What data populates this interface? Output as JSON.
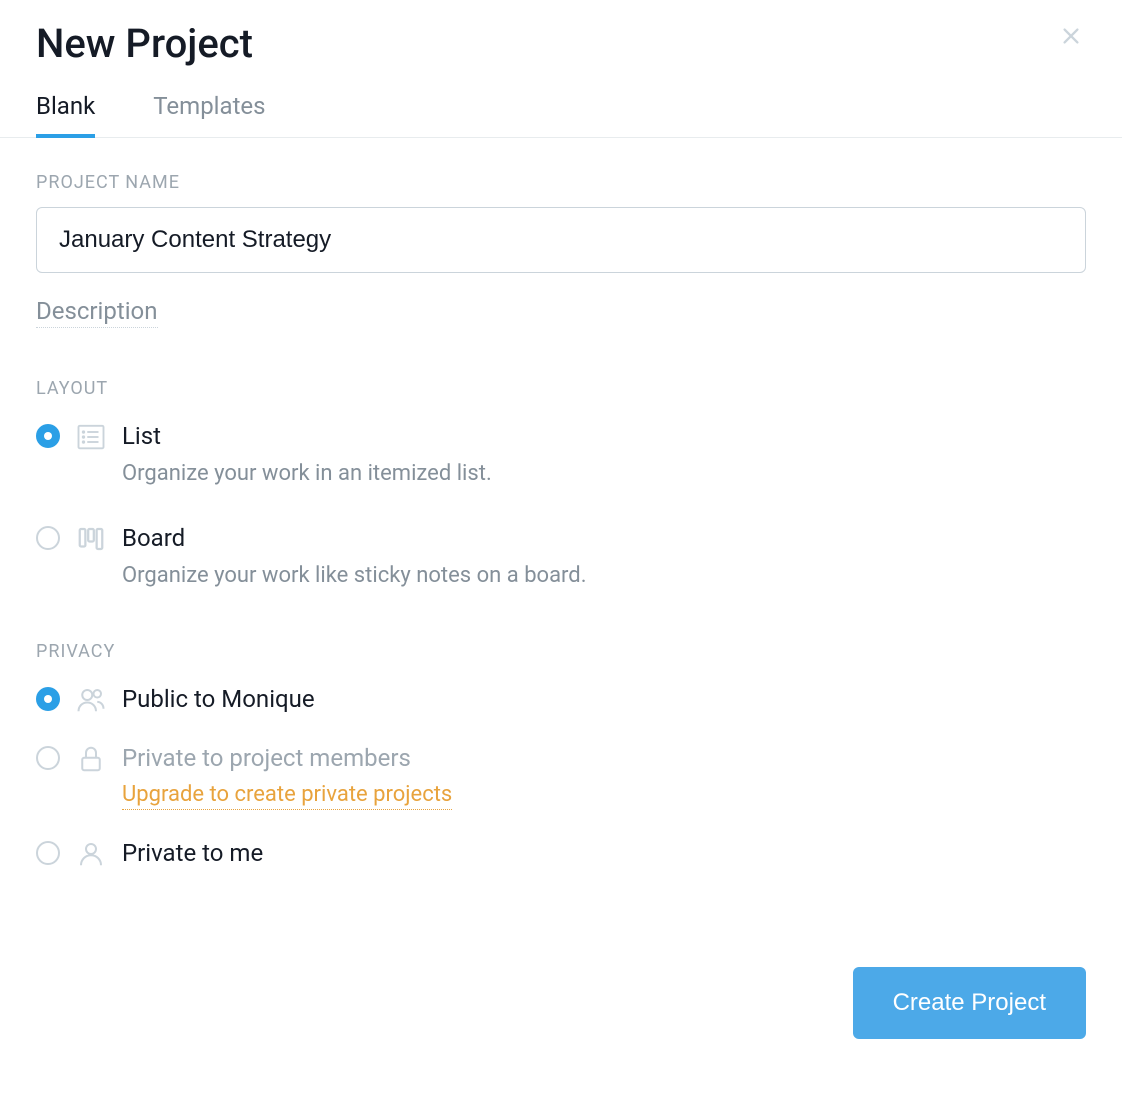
{
  "modal": {
    "title": "New Project",
    "tabs": [
      {
        "label": "Blank",
        "active": true
      },
      {
        "label": "Templates",
        "active": false
      }
    ],
    "project_name_label": "PROJECT NAME",
    "project_name_value": "January Content Strategy",
    "description_toggle": "Description",
    "layout_label": "LAYOUT",
    "layout_options": {
      "list": {
        "title": "List",
        "desc": "Organize your work in an itemized list."
      },
      "board": {
        "title": "Board",
        "desc": "Organize your work like sticky notes on a board."
      }
    },
    "privacy_label": "PRIVACY",
    "privacy_options": {
      "public": {
        "title": "Public to Monique"
      },
      "private_members": {
        "title": "Private to project members",
        "upgrade": "Upgrade to create private projects"
      },
      "private_me": {
        "title": "Private to me"
      }
    },
    "create_button": "Create Project"
  }
}
